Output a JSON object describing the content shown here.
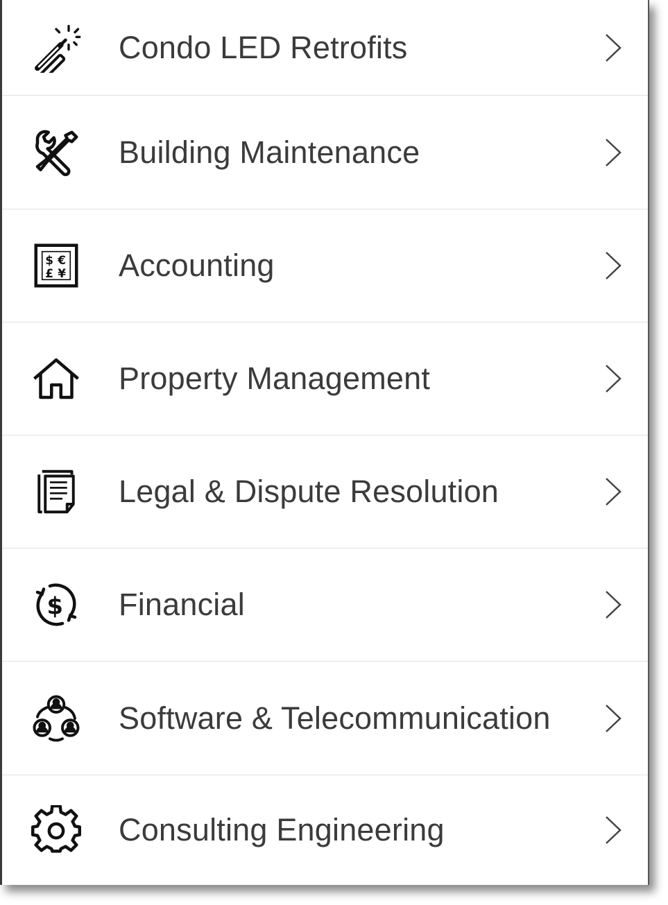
{
  "menu": {
    "items": [
      {
        "label": "Condo LED Retrofits",
        "icon": "magic-wand-icon"
      },
      {
        "label": "Building Maintenance",
        "icon": "wrench-screwdriver-icon"
      },
      {
        "label": "Accounting",
        "icon": "currency-box-icon"
      },
      {
        "label": "Property Management",
        "icon": "house-icon"
      },
      {
        "label": "Legal & Dispute Resolution",
        "icon": "documents-icon"
      },
      {
        "label": "Financial",
        "icon": "dollar-cycle-icon"
      },
      {
        "label": "Software & Telecommunication",
        "icon": "people-network-icon"
      },
      {
        "label": "Consulting Engineering",
        "icon": "gear-icon"
      }
    ],
    "chevron_icon": "chevron-right-icon"
  },
  "colors": {
    "text": "#3b3b3b",
    "divider": "#e1e1e1",
    "icon": "#111111",
    "chevron": "#444444"
  }
}
